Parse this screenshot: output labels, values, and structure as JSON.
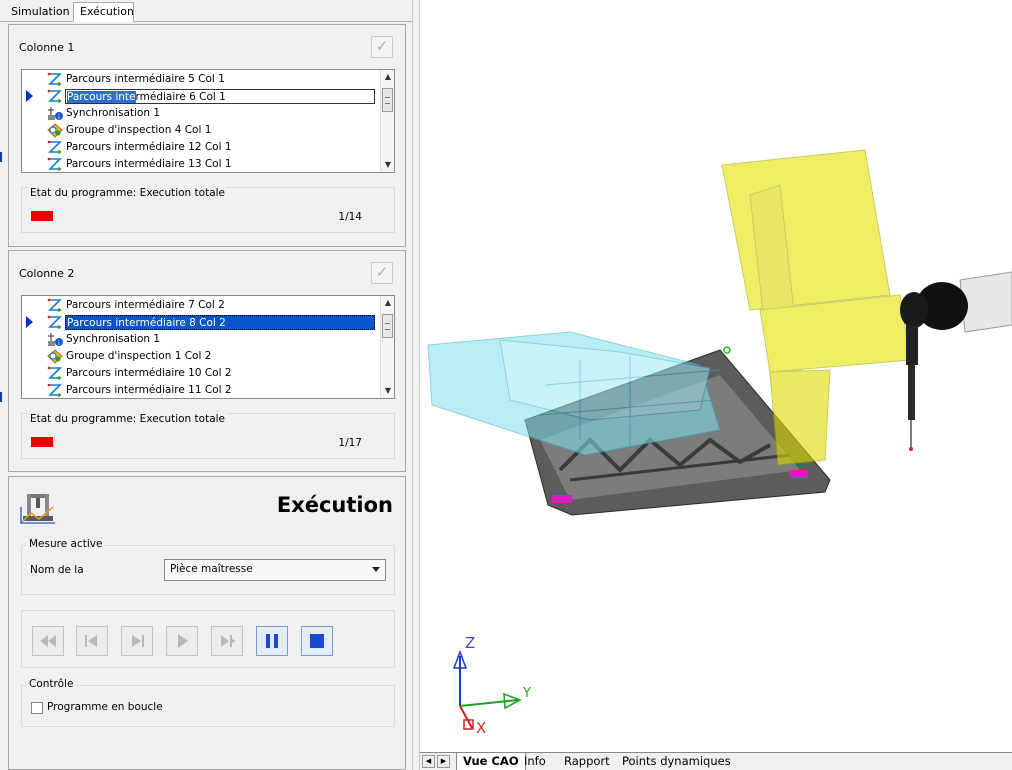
{
  "tabs": {
    "simulation": "Simulation",
    "execution": "Exécution"
  },
  "columns": [
    {
      "title": "Colonne 1",
      "items": [
        {
          "label": "Parcours intermédiaire 5 Col 1",
          "icon": "path-icon"
        },
        {
          "label": "Parcours intermédiaire 6 Col 1",
          "icon": "path-icon",
          "label_a": "Parcours inte",
          "label_b": "rmédiaire 6 Col 1"
        },
        {
          "label": "Synchronisation 1",
          "icon": "sync-icon"
        },
        {
          "label": "Groupe d'inspection 4 Col 1",
          "icon": "inspection-group-icon"
        },
        {
          "label": "Parcours intermédiaire 12 Col 1",
          "icon": "path-icon"
        },
        {
          "label": "Parcours intermédiaire 13 Col 1",
          "icon": "path-icon"
        }
      ],
      "state_label": "Etat du programme: Execution totale",
      "progress": "1/14"
    },
    {
      "title": "Colonne 2",
      "items": [
        {
          "label": "Parcours intermédiaire 7 Col 2",
          "icon": "path-icon"
        },
        {
          "label": "Parcours intermédiaire 8 Col 2",
          "icon": "path-icon"
        },
        {
          "label": "Synchronisation 1",
          "icon": "sync-icon"
        },
        {
          "label": "Groupe d'inspection 1 Col 2",
          "icon": "inspection-group-icon"
        },
        {
          "label": "Parcours intermédiaire 10 Col 2",
          "icon": "path-icon"
        },
        {
          "label": "Parcours intermédiaire 11 Col 2",
          "icon": "path-icon"
        }
      ],
      "state_label": "Etat du programme: Execution totale",
      "progress": "1/17"
    }
  ],
  "execution": {
    "title": "Exécution",
    "active_measure_legend": "Mesure active",
    "name_label": "Nom de la",
    "name_value": "Pièce maîtresse",
    "control_legend": "Contrôle",
    "loop_label": "Programme en boucle",
    "loop_checked": false
  },
  "viewport": {
    "axis_z": "Z",
    "axis_y": "Y",
    "axis_x": "X"
  },
  "bottom_tabs": [
    "Vue CAO",
    "Info",
    "Rapport",
    "Points dynamiques"
  ],
  "colors": {
    "selection": "#0a55c8",
    "status_red": "#ee0000",
    "probe_yellow": "#e4e400",
    "part_cyan": "#8ee6f0"
  }
}
